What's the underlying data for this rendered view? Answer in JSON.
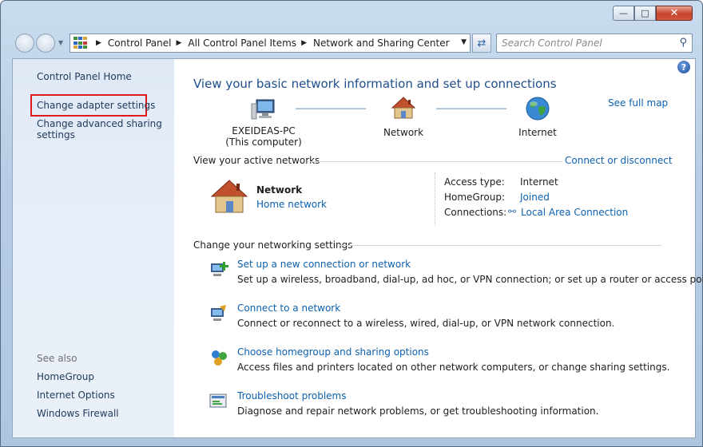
{
  "address_bar": {
    "crumbs": [
      "Control Panel",
      "All Control Panel Items",
      "Network and Sharing Center"
    ]
  },
  "search": {
    "placeholder": "Search Control Panel"
  },
  "sidebar": {
    "home": "Control Panel Home",
    "change_adapter": "Change adapter settings",
    "change_sharing_line1": "Change advanced sharing",
    "change_sharing_line2": "settings",
    "see_also": "See also",
    "homegroup": "HomeGroup",
    "internet_options": "Internet Options",
    "windows_firewall": "Windows Firewall"
  },
  "main": {
    "title": "View your basic network information and set up connections",
    "see_full_map": "See full map",
    "map": {
      "computer_name": "EXEIDEAS-PC",
      "computer_sub": "(This computer)",
      "network": "Network",
      "internet": "Internet"
    },
    "active_networks": {
      "heading": "View your active networks",
      "connect_link": "Connect or disconnect",
      "network_name": "Network",
      "network_type": "Home network",
      "access_type_label": "Access type:",
      "access_type_value": "Internet",
      "homegroup_label": "HomeGroup:",
      "homegroup_value": "Joined",
      "connections_label": "Connections:",
      "connections_value": "Local Area Connection"
    },
    "change_settings": {
      "heading": "Change your networking settings",
      "tasks": [
        {
          "link": "Set up a new connection or network",
          "desc": "Set up a wireless, broadband, dial-up, ad hoc, or VPN connection; or set up a router or access point."
        },
        {
          "link": "Connect to a network",
          "desc": "Connect or reconnect to a wireless, wired, dial-up, or VPN network connection."
        },
        {
          "link": "Choose homegroup and sharing options",
          "desc": "Access files and printers located on other network computers, or change sharing settings."
        },
        {
          "link": "Troubleshoot problems",
          "desc": "Diagnose and repair network problems, or get troubleshooting information."
        }
      ]
    }
  }
}
